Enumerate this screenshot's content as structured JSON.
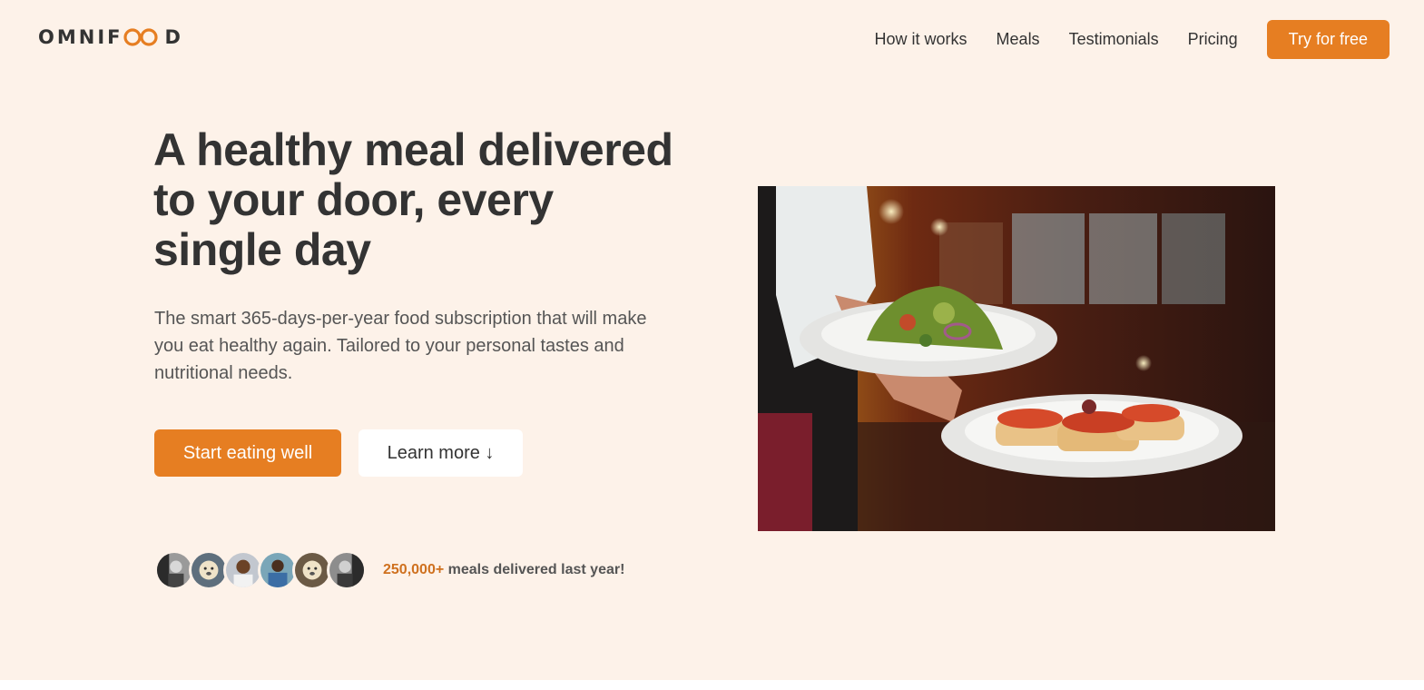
{
  "header": {
    "logo_text_left": "OMNIF",
    "logo_text_right": "D",
    "nav": [
      {
        "label": "How it works"
      },
      {
        "label": "Meals"
      },
      {
        "label": "Testimonials"
      },
      {
        "label": "Pricing"
      }
    ],
    "cta_label": "Try for free"
  },
  "hero": {
    "title": "A healthy meal delivered to your door, every single day",
    "description": "The smart 365-days-per-year food subscription that will make you eat healthy again. Tailored to your personal tastes and nutritional needs.",
    "primary_button": "Start eating well",
    "secondary_button": "Learn more ↓",
    "delivered_count": "250,000+",
    "delivered_text": " meals delivered last year!"
  },
  "colors": {
    "accent": "#e67e22",
    "accent_dark": "#cf711f",
    "background": "#fdf2e9",
    "text": "#333333"
  }
}
